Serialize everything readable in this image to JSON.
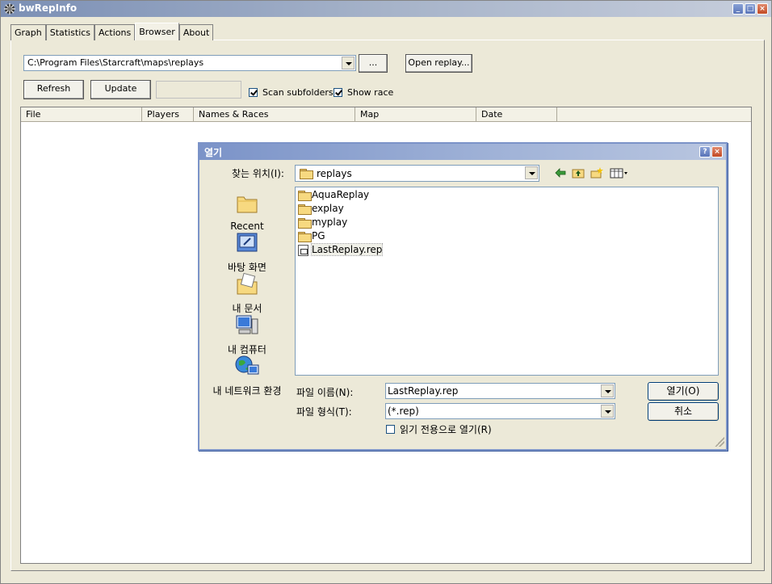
{
  "window": {
    "title": "bwRepInfo"
  },
  "tabs": [
    "Graph",
    "Statistics",
    "Actions",
    "Browser",
    "About"
  ],
  "active_tab": "Browser",
  "browser": {
    "path": "C:\\Program Files\\Starcraft\\maps\\replays",
    "browse_label": "...",
    "open_replay_label": "Open replay...",
    "refresh_label": "Refresh",
    "update_label": "Update",
    "scan_subfolders_label": "Scan subfolders",
    "scan_subfolders_checked": true,
    "show_race_label": "Show race",
    "show_race_checked": true,
    "columns": [
      "File",
      "Players",
      "Names & Races",
      "Map",
      "Date"
    ]
  },
  "dialog": {
    "title": "열기",
    "look_in_label": "찾는 위치(I):",
    "look_in_value": "replays",
    "places": [
      "Recent",
      "바탕 화면",
      "내 문서",
      "내 컴퓨터",
      "내 네트워크 환경"
    ],
    "files": [
      {
        "name": "AquaReplay",
        "type": "folder"
      },
      {
        "name": "explay",
        "type": "folder"
      },
      {
        "name": "myplay",
        "type": "folder"
      },
      {
        "name": "PG",
        "type": "folder"
      },
      {
        "name": "LastReplay.rep",
        "type": "file"
      }
    ],
    "filename_label": "파일 이름(N):",
    "filename_value": "LastReplay.rep",
    "filetype_label": "파일 형식(T):",
    "filetype_value": "(*.rep)",
    "readonly_label": "읽기 전용으로 열기(R)",
    "readonly_checked": false,
    "open_label": "열기(O)",
    "cancel_label": "취소"
  }
}
